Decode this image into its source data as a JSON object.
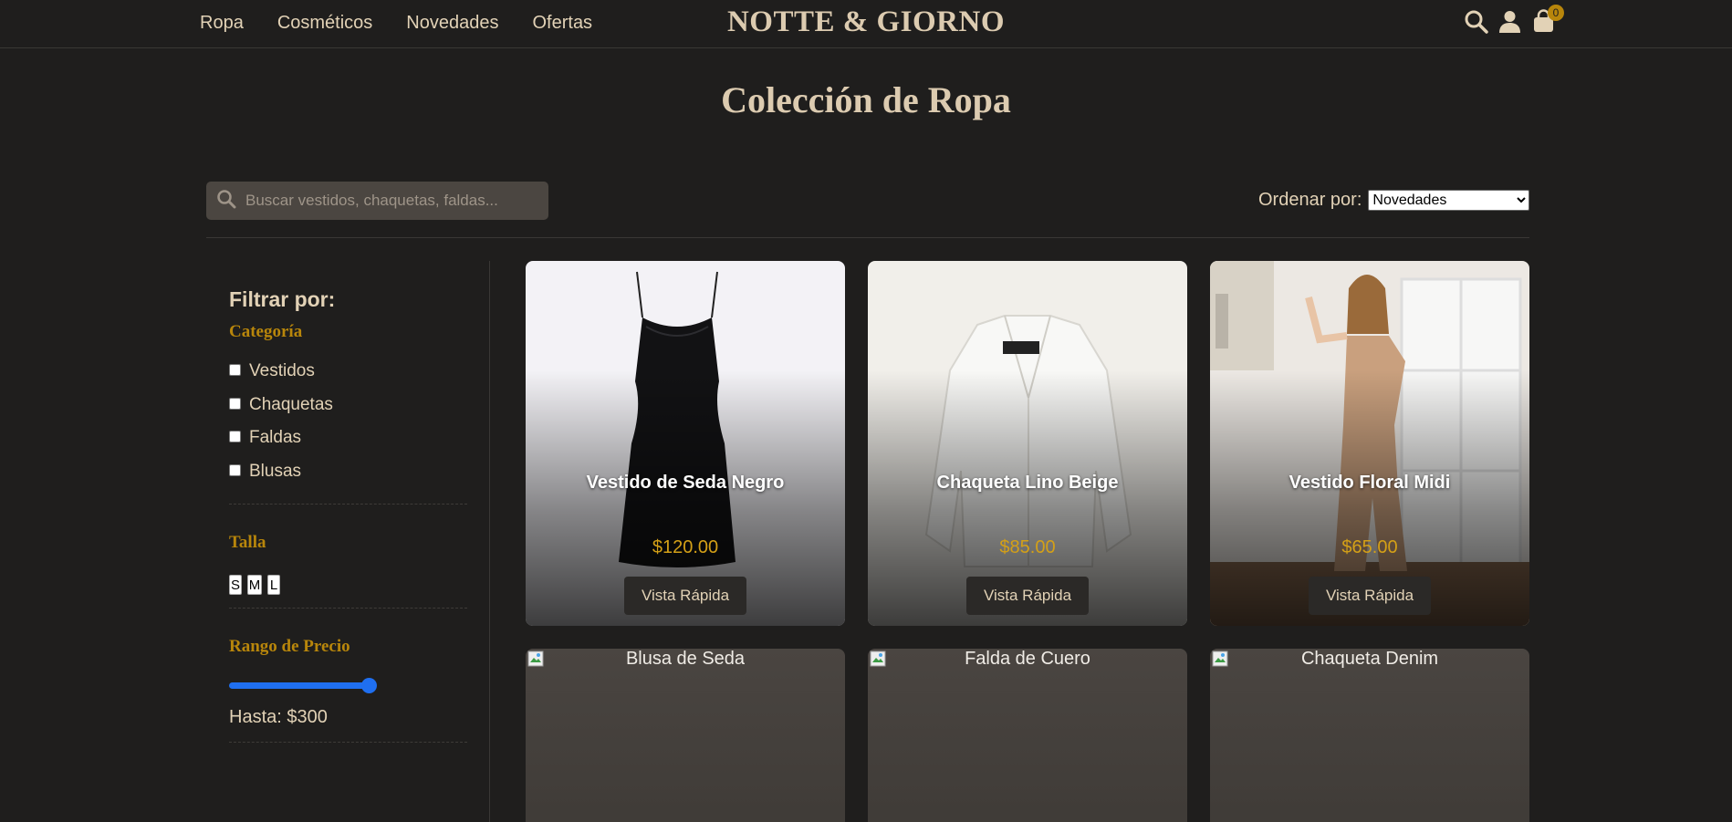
{
  "header": {
    "nav": [
      "Ropa",
      "Cosméticos",
      "Novedades",
      "Ofertas"
    ],
    "brand": "NOTTE & GIORNO",
    "icons": [
      "search-icon",
      "user-icon",
      "shopping-bag-icon"
    ],
    "cart_count": "0",
    "accent_color": "#b8860b"
  },
  "page": {
    "title": "Colección de Ropa"
  },
  "toolbar": {
    "search_placeholder": "Buscar vestidos, chaquetas, faldas...",
    "sort_label": "Ordenar por:",
    "sort_selected": "Novedades"
  },
  "sidebar": {
    "title": "Filtrar por:",
    "category_heading": "Categoría",
    "categories": [
      "Vestidos",
      "Chaquetas",
      "Faldas",
      "Blusas"
    ],
    "size_heading": "Talla",
    "sizes": [
      "S",
      "M",
      "L"
    ],
    "price_heading": "Rango de Precio",
    "price_max_label": "Hasta: $300",
    "price_slider_value": 300
  },
  "products": [
    {
      "name": "Vestido de Seda Negro",
      "price": "$120.00",
      "action": "Vista Rápida"
    },
    {
      "name": "Chaqueta Lino Beige",
      "price": "$85.00",
      "action": "Vista Rápida"
    },
    {
      "name": "Vestido Floral Midi",
      "price": "$65.00",
      "action": "Vista Rápida"
    },
    {
      "name": "Blusa de Seda"
    },
    {
      "name": "Falda de Cuero"
    },
    {
      "name": "Chaqueta Denim"
    }
  ]
}
